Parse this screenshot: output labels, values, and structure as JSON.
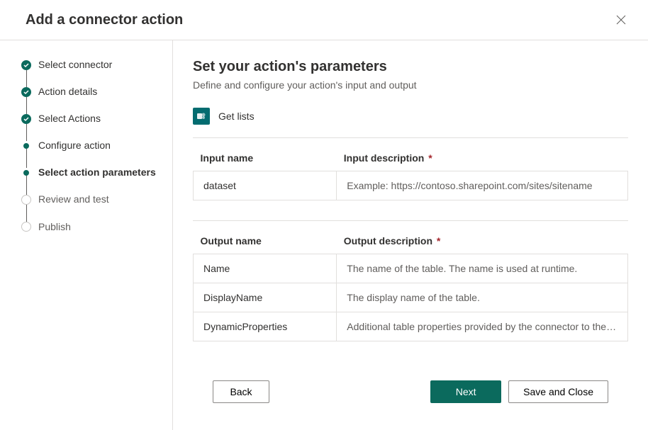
{
  "header": {
    "title": "Add a connector action"
  },
  "steps": [
    {
      "label": "Select connector",
      "state": "completed"
    },
    {
      "label": "Action details",
      "state": "completed"
    },
    {
      "label": "Select Actions",
      "state": "completed"
    },
    {
      "label": "Configure action",
      "state": "dot"
    },
    {
      "label": "Select action parameters",
      "state": "current"
    },
    {
      "label": "Review and test",
      "state": "pending"
    },
    {
      "label": "Publish",
      "state": "pending"
    }
  ],
  "page": {
    "title": "Set your action's parameters",
    "subtitle": "Define and configure your action's input and output"
  },
  "action": {
    "icon": "sharepoint-icon",
    "name": "Get lists"
  },
  "inputs": {
    "name_header": "Input name",
    "desc_header": "Input description",
    "required": "*",
    "rows": [
      {
        "name": "dataset",
        "desc": "Example: https://contoso.sharepoint.com/sites/sitename"
      }
    ]
  },
  "outputs": {
    "name_header": "Output name",
    "desc_header": "Output description",
    "required": "*",
    "rows": [
      {
        "name": "Name",
        "desc": "The name of the table. The name is used at runtime."
      },
      {
        "name": "DisplayName",
        "desc": "The display name of the table."
      },
      {
        "name": "DynamicProperties",
        "desc": "Additional table properties provided by the connector to the clients."
      }
    ]
  },
  "footer": {
    "back": "Back",
    "next": "Next",
    "save": "Save and Close"
  }
}
